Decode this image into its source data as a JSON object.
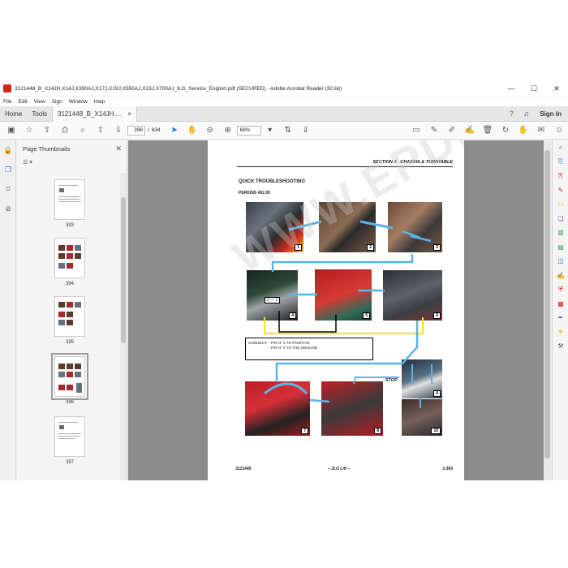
{
  "window": {
    "title": "3121448_B_X14JH,X14J,X390AJ,X17J,X19J,X550AJ,X23J,X700AJ_ILG_Service_English.pdf (SECURED) - Adobe Acrobat Reader (32-bit)",
    "minimize": "—",
    "maximize": "☐",
    "close": "✕"
  },
  "menu": [
    "File",
    "Edit",
    "View",
    "Sign",
    "Window",
    "Help"
  ],
  "tabs": {
    "home": "Home",
    "tools": "Tools",
    "document": "3121448_B_X14JH....",
    "document_close": "×",
    "signin": "Sign In"
  },
  "toolbar": {
    "current_page": "396",
    "page_separator": "/",
    "total_pages": "634",
    "zoom": "68%"
  },
  "thumbnails": {
    "title": "Page Thumbnails",
    "close": "✕",
    "pages": [
      {
        "number": "393",
        "selected": false
      },
      {
        "number": "394",
        "selected": false
      },
      {
        "number": "395",
        "selected": false
      },
      {
        "number": "396",
        "selected": true
      },
      {
        "number": "397",
        "selected": false
      }
    ]
  },
  "page": {
    "section_header": "SECTION 3 - CHASSIS & TURNTABLE",
    "title": "QUICK TROUBLESHOOTING",
    "subtitle": "PERKINS 402.05",
    "photo_numbers": [
      "1",
      "2",
      "3",
      "4",
      "5",
      "6",
      "7",
      "8",
      "9",
      "10"
    ],
    "pin_label": "2 — 1",
    "connect_label": "CONNECT:",
    "connect_line1": "- PIN Nº 1 TO POSITIVE",
    "connect_line2": "- PIN Nº 2 TO THE GROUND",
    "stop_label": "STOP",
    "footer_left": "3121448",
    "footer_mid": "– JLG Lift –",
    "footer_right": "3-369",
    "watermark": "WWW.EPDELG.COM"
  },
  "colors": {
    "accent": "#1473e6",
    "acrobat_red": "#d4271b",
    "arrow_blue": "#5ab4e6",
    "wire_yellow": "#f5e316"
  }
}
